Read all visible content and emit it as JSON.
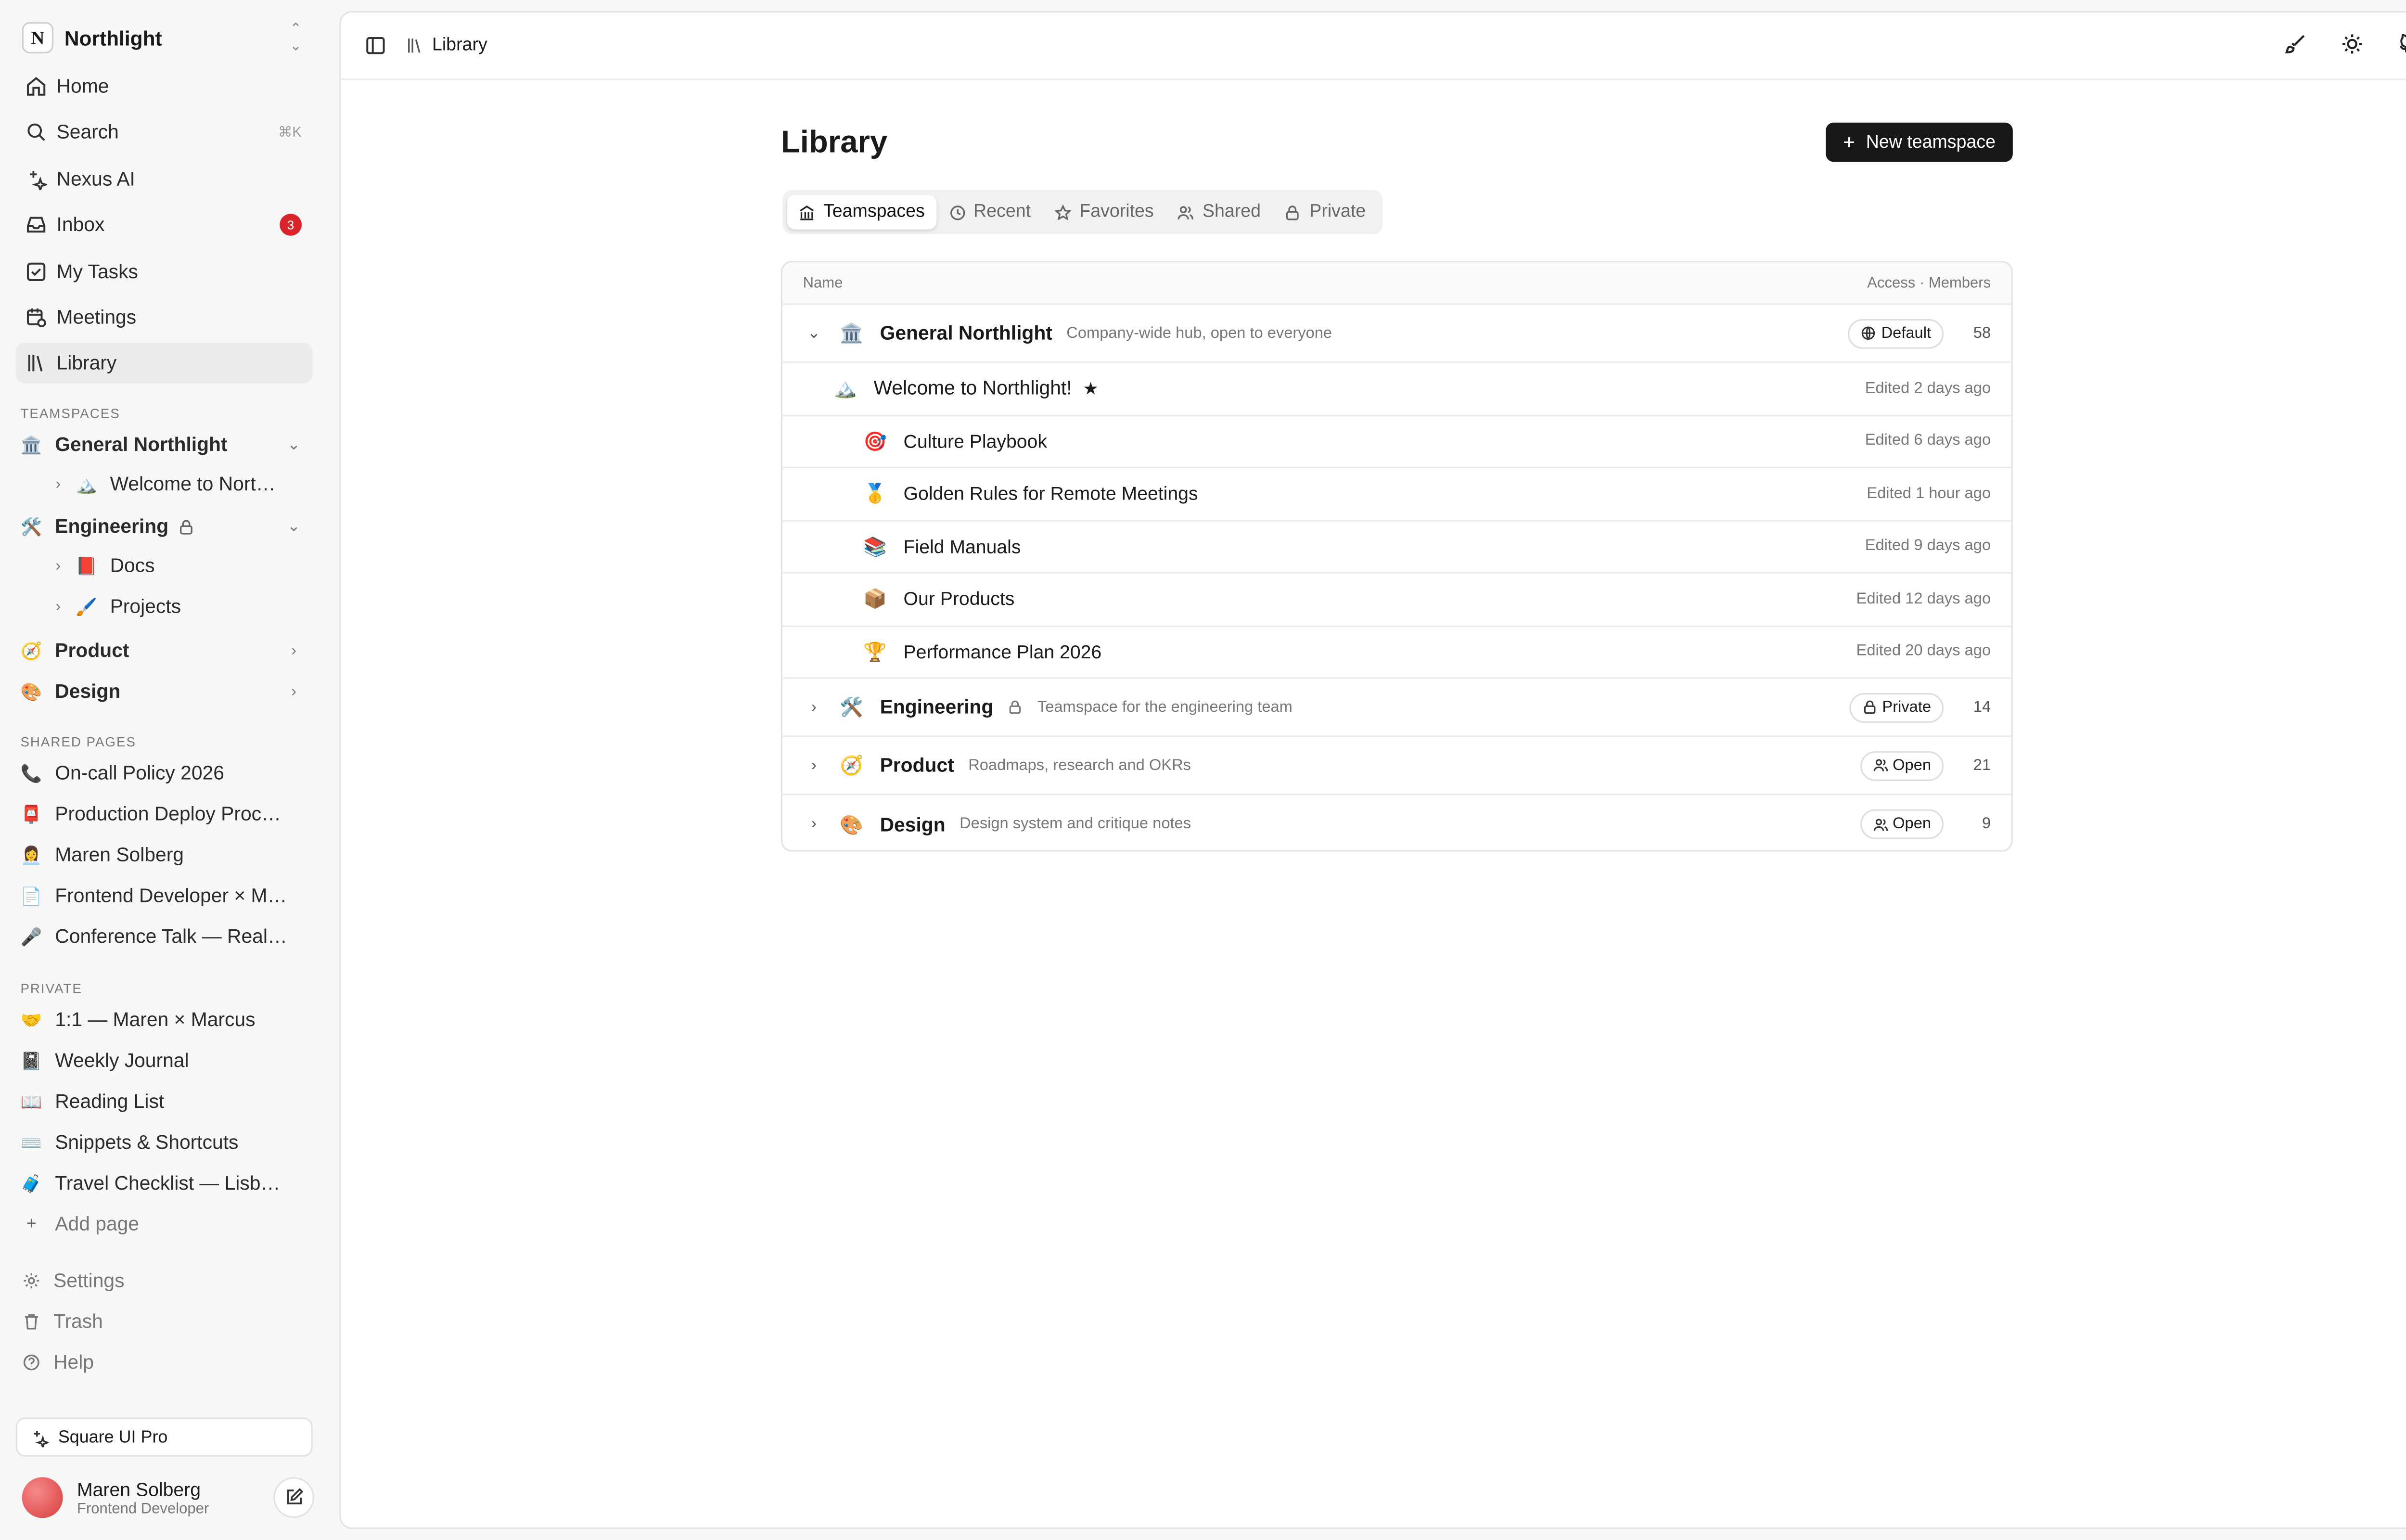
{
  "workspace": {
    "logo_letter": "N",
    "name": "Northlight"
  },
  "nav": [
    {
      "label": "Home"
    },
    {
      "label": "Search",
      "shortcut": "⌘K"
    },
    {
      "label": "Nexus AI"
    },
    {
      "label": "Inbox",
      "badge": "3"
    },
    {
      "label": "My Tasks"
    },
    {
      "label": "Meetings"
    },
    {
      "label": "Library"
    }
  ],
  "teamspaces_label": "TEAMSPACES",
  "teamspaces": [
    {
      "label": "General Northlight",
      "children": [
        {
          "label": "Welcome to Northlight!"
        }
      ]
    },
    {
      "label": "Engineering",
      "children": [
        {
          "label": "Docs"
        },
        {
          "label": "Projects"
        }
      ]
    },
    {
      "label": "Product"
    },
    {
      "label": "Design"
    }
  ],
  "shared_label": "SHARED PAGES",
  "shared": [
    {
      "emoji": "📞",
      "label": "On-call Policy 2026"
    },
    {
      "emoji": "📮",
      "label": "Production Deploy Process"
    },
    {
      "emoji": "👩‍💼",
      "label": "Maren Solberg"
    },
    {
      "emoji": "📄",
      "label": "Frontend Developer × Marcus"
    },
    {
      "emoji": "🎤",
      "label": "Conference Talk — Realtime"
    }
  ],
  "private_label": "PRIVATE",
  "private": [
    {
      "emoji": "🤝",
      "label": "1:1 — Maren × Marcus"
    },
    {
      "emoji": "📓",
      "label": "Weekly Journal"
    },
    {
      "emoji": "📖",
      "label": "Reading List"
    },
    {
      "emoji": "⌨️",
      "label": "Snippets & Shortcuts"
    },
    {
      "emoji": "🧳",
      "label": "Travel Checklist — Lisbon Offsite"
    }
  ],
  "add_page": "Add page",
  "footer_nav": [
    {
      "label": "Settings"
    },
    {
      "label": "Trash"
    },
    {
      "label": "Help"
    }
  ],
  "pro_card": "Square UI Pro",
  "user": {
    "name": "Maren Solberg",
    "role": "Frontend Developer"
  },
  "breadcrumb": "Library",
  "page_title": "Library",
  "new_button": "New teamspace",
  "tabs": [
    {
      "label": "Teamspaces",
      "active": true
    },
    {
      "label": "Recent"
    },
    {
      "label": "Favorites"
    },
    {
      "label": "Shared"
    },
    {
      "label": "Private"
    }
  ],
  "table": {
    "col_name": "Name",
    "col_access": "Access · Members",
    "general": {
      "emoji": "🏛️",
      "name": "General Northlight",
      "desc": "Company-wide hub, open to everyone",
      "access": "Default",
      "members": "58",
      "parent_page": {
        "emoji": "🏔️",
        "name": "Welcome to Northlight!",
        "edited": "Edited 2 days ago"
      },
      "pages": [
        {
          "emoji": "🎯",
          "name": "Culture Playbook",
          "edited": "Edited 6 days ago"
        },
        {
          "emoji": "🥇",
          "name": "Golden Rules for Remote Meetings",
          "edited": "Edited 1 hour ago"
        },
        {
          "emoji": "📚",
          "name": "Field Manuals",
          "edited": "Edited 9 days ago"
        },
        {
          "emoji": "📦",
          "name": "Our Products",
          "edited": "Edited 12 days ago"
        },
        {
          "emoji": "🏆",
          "name": "Performance Plan 2026",
          "edited": "Edited 20 days ago"
        }
      ]
    },
    "others": [
      {
        "emoji": "🛠️",
        "name": "Engineering",
        "desc": "Teamspace for the engineering team",
        "access": "Private",
        "members": "14"
      },
      {
        "emoji": "🧭",
        "name": "Product",
        "desc": "Roadmaps, research and OKRs",
        "access": "Open",
        "members": "21"
      },
      {
        "emoji": "🎨",
        "name": "Design",
        "desc": "Design system and critique notes",
        "access": "Open",
        "members": "9"
      }
    ]
  },
  "colors": {
    "accent": "#181818",
    "badge": "#d9252a",
    "active_bg": "#ececec"
  }
}
